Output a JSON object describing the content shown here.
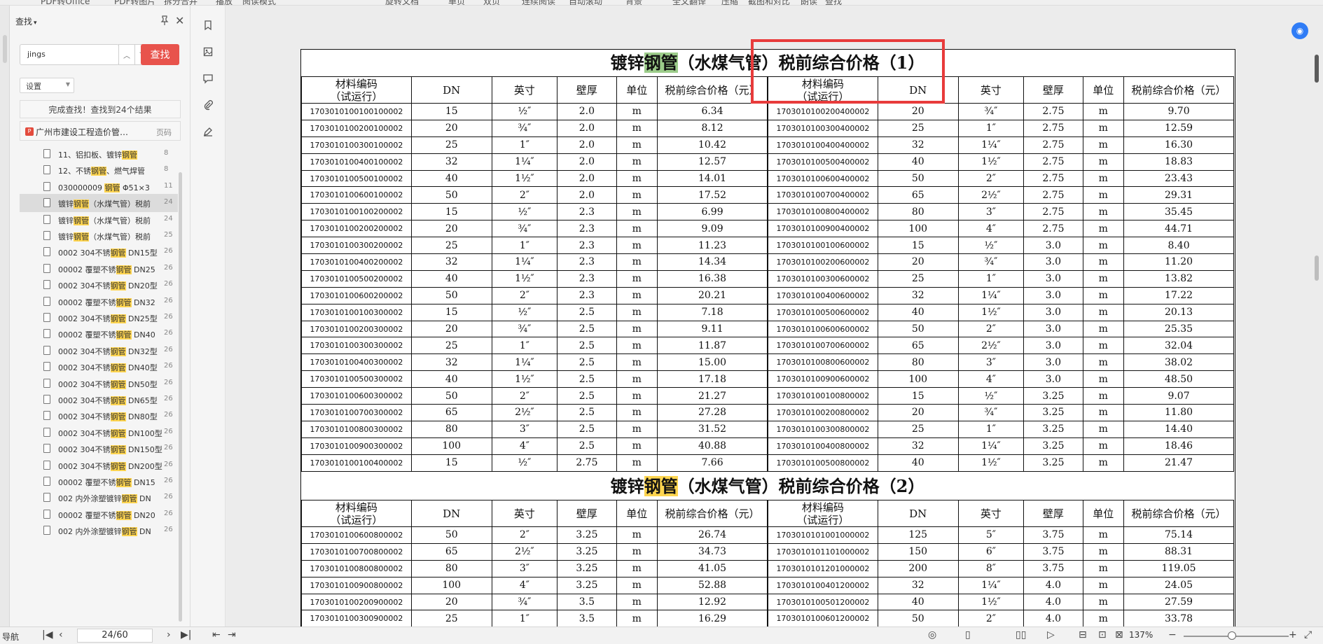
{
  "topbar": {
    "items": [
      "PDF转Office",
      "PDF转图片",
      "拆分合并",
      "播放",
      "阅读模式",
      "旋转文档",
      "单页",
      "双页",
      "连续阅读",
      "自动滚动",
      "背景",
      "全文翻译",
      "压缩",
      "截图和对比",
      "朗读",
      "查找"
    ]
  },
  "search_panel": {
    "header": "查找",
    "query": "jings",
    "find_label": "查找",
    "settings_label": "设置",
    "status": "完成查找！查找到24个结果",
    "doc_title": "广州市建设工程造价管…",
    "page_col": "页码",
    "results": [
      {
        "pre": "11、铝扣板、镀锌",
        "hl": "钢管",
        "post": "",
        "page": "8"
      },
      {
        "pre": "12、不锈",
        "hl": "钢管",
        "post": "、燃气焊管",
        "page": "8"
      },
      {
        "pre": "030000009 ",
        "hl": "钢管",
        "post": " Φ51×3",
        "page": "11"
      },
      {
        "pre": "镀锌",
        "hl": "钢管",
        "post": "（水煤气管）税前",
        "page": "24",
        "active": true
      },
      {
        "pre": "镀锌",
        "hl": "钢管",
        "post": "（水煤气管）税前",
        "page": "24"
      },
      {
        "pre": "镀锌",
        "hl": "钢管",
        "post": "（水煤气管）税前",
        "page": "25"
      },
      {
        "pre": "0002 304不锈",
        "hl": "钢管",
        "post": " DN15型",
        "page": "26"
      },
      {
        "pre": "00002 覆塑不锈",
        "hl": "钢管",
        "post": " DN25",
        "page": "26"
      },
      {
        "pre": "0002 304不锈",
        "hl": "钢管",
        "post": " DN20型",
        "page": "26"
      },
      {
        "pre": "00002 覆塑不锈",
        "hl": "钢管",
        "post": " DN32",
        "page": "26"
      },
      {
        "pre": "0002 304不锈",
        "hl": "钢管",
        "post": " DN25型",
        "page": "26"
      },
      {
        "pre": "00002 覆塑不锈",
        "hl": "钢管",
        "post": " DN40",
        "page": "26"
      },
      {
        "pre": "0002 304不锈",
        "hl": "钢管",
        "post": " DN32型",
        "page": "26"
      },
      {
        "pre": "0002 304不锈",
        "hl": "钢管",
        "post": " DN40型",
        "page": "26"
      },
      {
        "pre": "0002 304不锈",
        "hl": "钢管",
        "post": " DN50型",
        "page": "26"
      },
      {
        "pre": "0002 304不锈",
        "hl": "钢管",
        "post": " DN65型",
        "page": "26"
      },
      {
        "pre": "0002 304不锈",
        "hl": "钢管",
        "post": " DN80型",
        "page": "26"
      },
      {
        "pre": "0002 304不锈",
        "hl": "钢管",
        "post": " DN100型",
        "page": "26"
      },
      {
        "pre": "0002 304不锈",
        "hl": "钢管",
        "post": " DN150型",
        "page": "26"
      },
      {
        "pre": "0002 304不锈",
        "hl": "钢管",
        "post": " DN200型",
        "page": "26"
      },
      {
        "pre": "00002 覆塑不锈",
        "hl": "钢管",
        "post": " DN15",
        "page": "26"
      },
      {
        "pre": "002 内外涂塑镀锌",
        "hl": "钢管",
        "post": " DN",
        "page": "26"
      },
      {
        "pre": "00002 覆塑不锈",
        "hl": "钢管",
        "post": " DN20",
        "page": "26"
      },
      {
        "pre": "002 内外涂塑镀锌",
        "hl": "钢管",
        "post": " DN",
        "page": "26"
      }
    ]
  },
  "document": {
    "table1": {
      "title_pre": "镀锌",
      "title_kw": "钢管",
      "title_post": "（水煤气管）税前综合价格（1）",
      "headers": [
        "材料编码\n（试运行）",
        "DN",
        "英寸",
        "壁厚",
        "单位",
        "税前综合价格（元）"
      ],
      "left_rows": [
        [
          "1703010100100100002",
          "15",
          "½″",
          "2.0",
          "m",
          "6.34"
        ],
        [
          "1703010100200100002",
          "20",
          "¾″",
          "2.0",
          "m",
          "8.12"
        ],
        [
          "1703010100300100002",
          "25",
          "1″",
          "2.0",
          "m",
          "10.42"
        ],
        [
          "1703010100400100002",
          "32",
          "1¼″",
          "2.0",
          "m",
          "12.57"
        ],
        [
          "1703010100500100002",
          "40",
          "1½″",
          "2.0",
          "m",
          "14.01"
        ],
        [
          "1703010100600100002",
          "50",
          "2″",
          "2.0",
          "m",
          "17.52"
        ],
        [
          "1703010100100200002",
          "15",
          "½″",
          "2.3",
          "m",
          "6.99"
        ],
        [
          "1703010100200200002",
          "20",
          "¾″",
          "2.3",
          "m",
          "9.09"
        ],
        [
          "1703010100300200002",
          "25",
          "1″",
          "2.3",
          "m",
          "11.23"
        ],
        [
          "1703010100400200002",
          "32",
          "1¼″",
          "2.3",
          "m",
          "14.34"
        ],
        [
          "1703010100500200002",
          "40",
          "1½″",
          "2.3",
          "m",
          "16.38"
        ],
        [
          "1703010100600200002",
          "50",
          "2″",
          "2.3",
          "m",
          "20.21"
        ],
        [
          "1703010100100300002",
          "15",
          "½″",
          "2.5",
          "m",
          "7.18"
        ],
        [
          "1703010100200300002",
          "20",
          "¾″",
          "2.5",
          "m",
          "9.11"
        ],
        [
          "1703010100300300002",
          "25",
          "1″",
          "2.5",
          "m",
          "11.87"
        ],
        [
          "1703010100400300002",
          "32",
          "1¼″",
          "2.5",
          "m",
          "15.00"
        ],
        [
          "1703010100500300002",
          "40",
          "1½″",
          "2.5",
          "m",
          "17.18"
        ],
        [
          "1703010100600300002",
          "50",
          "2″",
          "2.5",
          "m",
          "21.27"
        ],
        [
          "1703010100700300002",
          "65",
          "2½″",
          "2.5",
          "m",
          "27.28"
        ],
        [
          "1703010100800300002",
          "80",
          "3″",
          "2.5",
          "m",
          "31.52"
        ],
        [
          "1703010100900300002",
          "100",
          "4″",
          "2.5",
          "m",
          "40.88"
        ],
        [
          "1703010100100400002",
          "15",
          "½″",
          "2.75",
          "m",
          "7.66"
        ]
      ],
      "right_rows": [
        [
          "1703010100200400002",
          "20",
          "¾″",
          "2.75",
          "m",
          "9.70"
        ],
        [
          "1703010100300400002",
          "25",
          "1″",
          "2.75",
          "m",
          "12.59"
        ],
        [
          "1703010100400400002",
          "32",
          "1¼″",
          "2.75",
          "m",
          "16.30"
        ],
        [
          "1703010100500400002",
          "40",
          "1½″",
          "2.75",
          "m",
          "18.83"
        ],
        [
          "1703010100600400002",
          "50",
          "2″",
          "2.75",
          "m",
          "23.43"
        ],
        [
          "1703010100700400002",
          "65",
          "2½″",
          "2.75",
          "m",
          "29.31"
        ],
        [
          "1703010100800400002",
          "80",
          "3″",
          "2.75",
          "m",
          "35.45"
        ],
        [
          "1703010100900400002",
          "100",
          "4″",
          "2.75",
          "m",
          "44.71"
        ],
        [
          "1703010100100600002",
          "15",
          "½″",
          "3.0",
          "m",
          "8.40"
        ],
        [
          "1703010100200600002",
          "20",
          "¾″",
          "3.0",
          "m",
          "11.20"
        ],
        [
          "1703010100300600002",
          "25",
          "1″",
          "3.0",
          "m",
          "13.82"
        ],
        [
          "1703010100400600002",
          "32",
          "1¼″",
          "3.0",
          "m",
          "17.22"
        ],
        [
          "1703010100500600002",
          "40",
          "1½″",
          "3.0",
          "m",
          "20.13"
        ],
        [
          "1703010100600600002",
          "50",
          "2″",
          "3.0",
          "m",
          "25.35"
        ],
        [
          "1703010100700600002",
          "65",
          "2½″",
          "3.0",
          "m",
          "32.04"
        ],
        [
          "1703010100800600002",
          "80",
          "3″",
          "3.0",
          "m",
          "38.02"
        ],
        [
          "1703010100900600002",
          "100",
          "4″",
          "3.0",
          "m",
          "48.50"
        ],
        [
          "1703010100100800002",
          "15",
          "½″",
          "3.25",
          "m",
          "9.07"
        ],
        [
          "1703010100200800002",
          "20",
          "¾″",
          "3.25",
          "m",
          "11.80"
        ],
        [
          "1703010100300800002",
          "25",
          "1″",
          "3.25",
          "m",
          "14.40"
        ],
        [
          "1703010100400800002",
          "32",
          "1¼″",
          "3.25",
          "m",
          "18.46"
        ],
        [
          "1703010100500800002",
          "40",
          "1½″",
          "3.25",
          "m",
          "21.47"
        ]
      ]
    },
    "table2": {
      "title_pre": "镀锌",
      "title_kw": "钢管",
      "title_post": "（水煤气管）税前综合价格（2）",
      "headers": [
        "材料编码\n（试运行）",
        "DN",
        "英寸",
        "壁厚",
        "单位",
        "税前综合价格（元）"
      ],
      "left_rows": [
        [
          "1703010100600800002",
          "50",
          "2″",
          "3.25",
          "m",
          "26.74"
        ],
        [
          "1703010100700800002",
          "65",
          "2½″",
          "3.25",
          "m",
          "34.73"
        ],
        [
          "1703010100800800002",
          "80",
          "3″",
          "3.25",
          "m",
          "41.05"
        ],
        [
          "1703010100900800002",
          "100",
          "4″",
          "3.25",
          "m",
          "52.88"
        ],
        [
          "1703010100200900002",
          "20",
          "¾″",
          "3.5",
          "m",
          "12.92"
        ],
        [
          "1703010100300900002",
          "25",
          "1″",
          "3.5",
          "m",
          "16.29"
        ]
      ],
      "right_rows": [
        [
          "1703010101001000002",
          "125",
          "5″",
          "3.75",
          "m",
          "75.14"
        ],
        [
          "1703010101101000002",
          "150",
          "6″",
          "3.75",
          "m",
          "88.31"
        ],
        [
          "1703010101201000002",
          "200",
          "8″",
          "3.75",
          "m",
          "119.05"
        ],
        [
          "1703010100401200002",
          "32",
          "1¼″",
          "4.0",
          "m",
          "24.05"
        ],
        [
          "1703010100501200002",
          "40",
          "1½″",
          "4.0",
          "m",
          "27.59"
        ],
        [
          "1703010100601200002",
          "50",
          "2″",
          "4.0",
          "m",
          "33.78"
        ]
      ]
    }
  },
  "ime": {
    "logo": "S",
    "lang": "中",
    "punct": "°,"
  },
  "statusbar": {
    "nav_label": "导航",
    "page": "24/60",
    "zoom": "137%"
  }
}
